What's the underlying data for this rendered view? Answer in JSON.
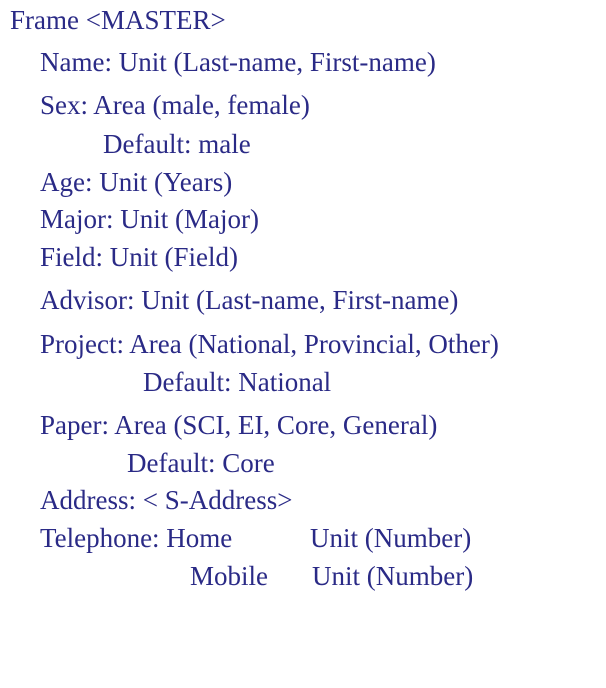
{
  "frame": {
    "header": "Frame <MASTER>",
    "fields": {
      "name": "Name: Unit (Last-name, First-name)",
      "sex": "Sex: Area (male, female)",
      "sex_default": "Default: male",
      "age": "Age: Unit (Years)",
      "major": "Major: Unit (Major)",
      "field": "Field: Unit (Field)",
      "advisor": "Advisor: Unit (Last-name, First-name)",
      "project": "Project: Area (National, Provincial, Other)",
      "project_default": "Default: National",
      "paper": "Paper: Area (SCI, EI, Core, General)",
      "paper_default": "Default: Core",
      "address": "Address: < S-Address>",
      "telephone_label": "Telephone: Home",
      "telephone_home_unit": "Unit (Number)",
      "telephone_mobile_label": "Mobile",
      "telephone_mobile_unit": "Unit (Number)"
    }
  }
}
